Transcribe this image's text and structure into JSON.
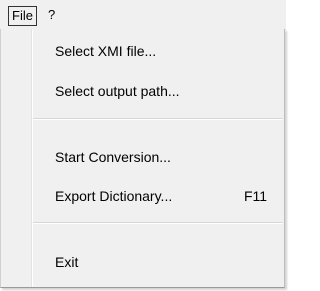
{
  "menubar": {
    "file_label": "File",
    "help_label": "?"
  },
  "file_menu": {
    "items": [
      {
        "label": "Select XMI file..."
      },
      {
        "label": "Select output path..."
      },
      {
        "label": "Start Conversion..."
      },
      {
        "label": "Export Dictionary...",
        "shortcut": "F11"
      },
      {
        "label": "Exit"
      }
    ]
  }
}
